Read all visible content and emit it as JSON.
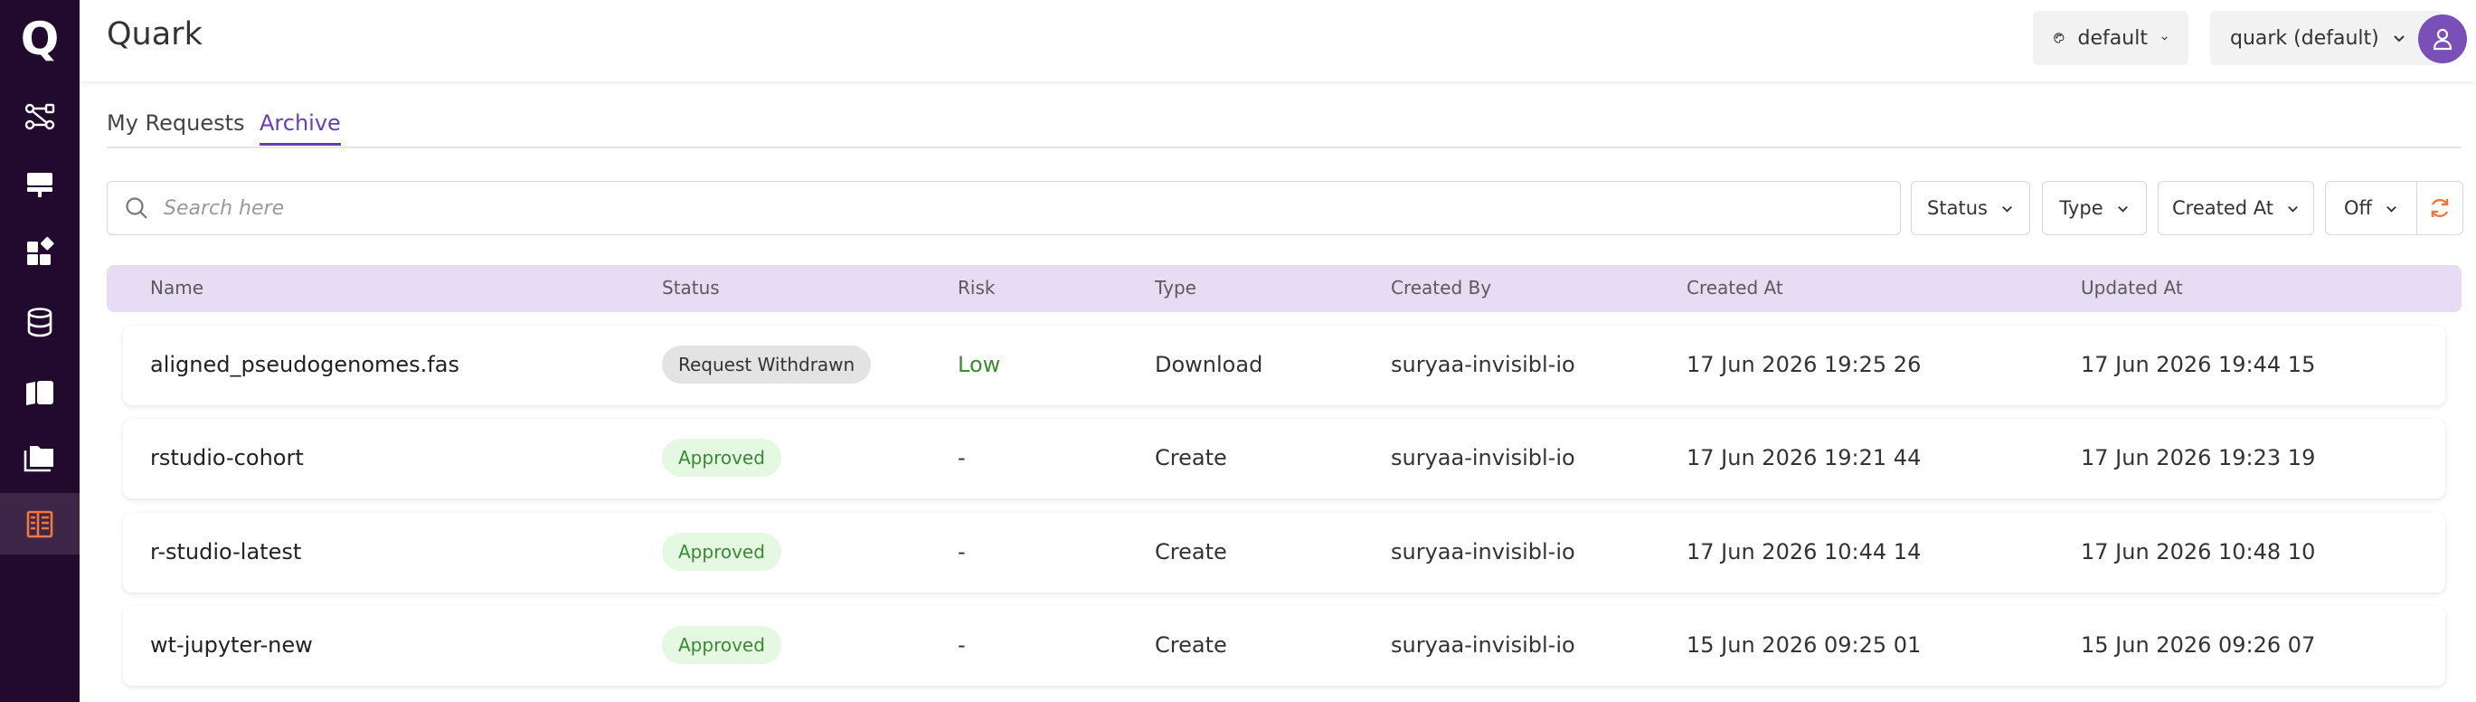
{
  "app": {
    "title": "Quark",
    "logo_letter": "Q"
  },
  "header": {
    "theme_label": "default",
    "workspace_label": "quark (default)"
  },
  "sidebar": {
    "items": [
      {
        "name": "workflow"
      },
      {
        "name": "compute"
      },
      {
        "name": "apps"
      },
      {
        "name": "database"
      },
      {
        "name": "notebooks"
      },
      {
        "name": "files"
      },
      {
        "name": "requests",
        "active": true
      }
    ]
  },
  "tabs": [
    {
      "label": "My Requests",
      "active": false
    },
    {
      "label": "Archive",
      "active": true
    }
  ],
  "search": {
    "placeholder": "Search here"
  },
  "filters": {
    "status": "Status",
    "type": "Type",
    "created_at": "Created At",
    "auto_refresh": "Off"
  },
  "table": {
    "columns": [
      "Name",
      "Status",
      "Risk",
      "Type",
      "Created By",
      "Created At",
      "Updated At"
    ],
    "rows": [
      {
        "name": "aligned_pseudogenomes.fas",
        "status": "Request Withdrawn",
        "status_kind": "gray",
        "risk": "Low",
        "type": "Download",
        "created_by": "suryaa-invisibl-io",
        "created_at": "17 Jun 2026 19:25 26",
        "updated_at": "17 Jun 2026 19:44 15"
      },
      {
        "name": "rstudio-cohort",
        "status": "Approved",
        "status_kind": "green",
        "risk": "-",
        "type": "Create",
        "created_by": "suryaa-invisibl-io",
        "created_at": "17 Jun 2026 19:21 44",
        "updated_at": "17 Jun 2026 19:23 19"
      },
      {
        "name": "r-studio-latest",
        "status": "Approved",
        "status_kind": "green",
        "risk": "-",
        "type": "Create",
        "created_by": "suryaa-invisibl-io",
        "created_at": "17 Jun 2026 10:44 14",
        "updated_at": "17 Jun 2026 10:48 10"
      },
      {
        "name": "wt-jupyter-new",
        "status": "Approved",
        "status_kind": "green",
        "risk": "-",
        "type": "Create",
        "created_by": "suryaa-invisibl-io",
        "created_at": "15 Jun 2026 09:25 01",
        "updated_at": "15 Jun 2026 09:26 07"
      }
    ]
  },
  "colors": {
    "sidebar_bg": "#210a2e",
    "accent": "#6a3db8",
    "table_header_bg": "#e6dcf3",
    "approved_bg": "#e5f8e2",
    "approved_text": "#3a8a34",
    "refresh_icon": "#f0763a"
  }
}
